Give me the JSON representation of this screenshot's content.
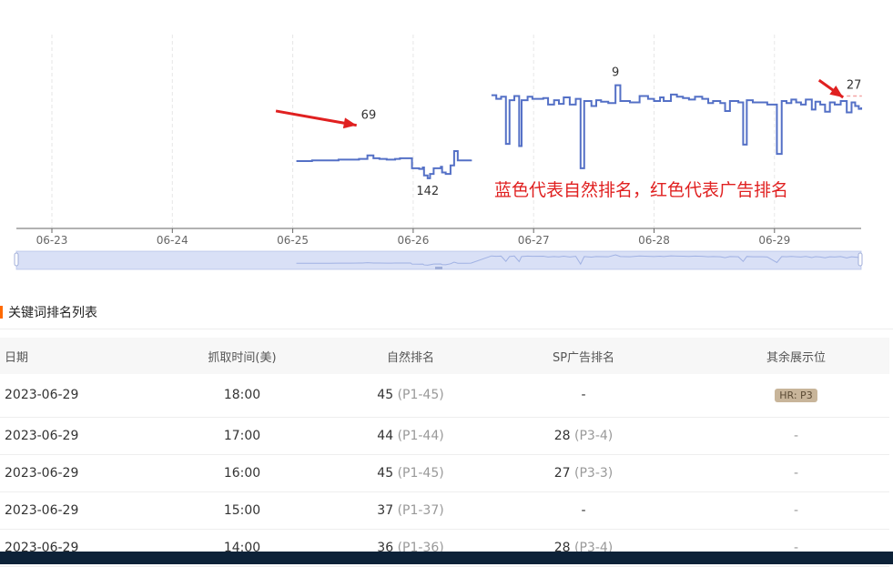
{
  "chart_data": {
    "type": "line",
    "x_ticks": [
      "06-23",
      "06-24",
      "06-25",
      "06-26",
      "06-27",
      "06-28",
      "06-29"
    ],
    "y_axis": {
      "reversed": true,
      "ylim": [
        1,
        160
      ],
      "visible": false
    },
    "grid": {
      "x": true,
      "y": false
    },
    "series": [
      {
        "color": "#5470c6",
        "points": [
          [
            2.03,
            118
          ],
          [
            2.09,
            118
          ],
          [
            2.16,
            117
          ],
          [
            2.21,
            117
          ],
          [
            2.31,
            117
          ],
          [
            2.38,
            116
          ],
          [
            2.44,
            116
          ],
          [
            2.49,
            116
          ],
          [
            2.55,
            115
          ],
          [
            2.58,
            115
          ],
          [
            2.62,
            110
          ],
          [
            2.67,
            114
          ],
          [
            2.72,
            115
          ],
          [
            2.78,
            116
          ],
          [
            2.82,
            116
          ],
          [
            2.85,
            115
          ],
          [
            2.89,
            114
          ],
          [
            2.93,
            114
          ],
          [
            2.98,
            114
          ],
          [
            2.99,
            128
          ],
          [
            3.05,
            129
          ],
          [
            3.08,
            127
          ],
          [
            3.09,
            138
          ],
          [
            3.12,
            142
          ],
          [
            3.14,
            136
          ],
          [
            3.17,
            128
          ],
          [
            3.23,
            126
          ],
          [
            3.24,
            134
          ],
          [
            3.27,
            136
          ],
          [
            3.31,
            124
          ],
          [
            3.34,
            104
          ],
          [
            3.37,
            117
          ],
          [
            3.44,
            117
          ],
          [
            3.48,
            116
          ],
          [
            3.65,
            26
          ],
          [
            3.69,
            31
          ],
          [
            3.73,
            28
          ],
          [
            3.77,
            94
          ],
          [
            3.8,
            33
          ],
          [
            3.84,
            27
          ],
          [
            3.88,
            97
          ],
          [
            3.9,
            33
          ],
          [
            3.95,
            28
          ],
          [
            3.99,
            31
          ],
          [
            4.08,
            30
          ],
          [
            4.12,
            39
          ],
          [
            4.17,
            33
          ],
          [
            4.21,
            38
          ],
          [
            4.25,
            29
          ],
          [
            4.3,
            39
          ],
          [
            4.35,
            31
          ],
          [
            4.39,
            128
          ],
          [
            4.42,
            34
          ],
          [
            4.48,
            41
          ],
          [
            4.52,
            33
          ],
          [
            4.56,
            35
          ],
          [
            4.62,
            37
          ],
          [
            4.68,
            12
          ],
          [
            4.72,
            34
          ],
          [
            4.8,
            36
          ],
          [
            4.88,
            27
          ],
          [
            4.95,
            31
          ],
          [
            5.0,
            34
          ],
          [
            5.05,
            29
          ],
          [
            5.08,
            34
          ],
          [
            5.14,
            25
          ],
          [
            5.19,
            28
          ],
          [
            5.24,
            30
          ],
          [
            5.29,
            32
          ],
          [
            5.34,
            28
          ],
          [
            5.4,
            31
          ],
          [
            5.45,
            37
          ],
          [
            5.49,
            34
          ],
          [
            5.55,
            37
          ],
          [
            5.59,
            48
          ],
          [
            5.63,
            34
          ],
          [
            5.7,
            36
          ],
          [
            5.74,
            95
          ],
          [
            5.77,
            33
          ],
          [
            5.82,
            36
          ],
          [
            5.9,
            36
          ],
          [
            5.94,
            39
          ],
          [
            6.02,
            108
          ],
          [
            6.06,
            34
          ],
          [
            6.1,
            37
          ],
          [
            6.14,
            32
          ],
          [
            6.18,
            36
          ],
          [
            6.22,
            39
          ],
          [
            6.26,
            32
          ],
          [
            6.31,
            46
          ],
          [
            6.34,
            35
          ],
          [
            6.38,
            39
          ],
          [
            6.42,
            49
          ],
          [
            6.46,
            36
          ],
          [
            6.5,
            39
          ],
          [
            6.55,
            34
          ],
          [
            6.6,
            50
          ],
          [
            6.64,
            36
          ],
          [
            6.67,
            41
          ],
          [
            6.7,
            45
          ],
          [
            6.72,
            43
          ]
        ]
      },
      {
        "color": "#f4a4a4",
        "points": [
          [
            2.63,
            69
          ],
          [
            6.6,
            27
          ],
          [
            6.66,
            27
          ],
          [
            6.72,
            28
          ]
        ]
      }
    ],
    "data_labels": [
      {
        "text": "69",
        "x": 2.63,
        "y": 69
      },
      {
        "text": "142",
        "x": 3.12,
        "y": 142
      },
      {
        "text": "9",
        "x": 4.68,
        "y": 9
      },
      {
        "text": "27",
        "x": 6.66,
        "y": 27
      }
    ],
    "annotation": {
      "text": "蓝色代表自然排名，红色代表广告排名",
      "color": "#e02020"
    },
    "arrows": [
      {
        "from": [
          1.86,
          48
        ],
        "to": [
          2.53,
          68
        ],
        "color": "#e02020"
      },
      {
        "from": [
          6.37,
          5
        ],
        "to": [
          6.57,
          29
        ],
        "color": "#e02020"
      }
    ],
    "range_selector": {
      "start": 0.0,
      "end": 1.0
    }
  },
  "section": {
    "title": "关键词排名列表"
  },
  "table": {
    "headers": [
      "日期",
      "抓取时间(美)",
      "自然排名",
      "SP广告排名",
      "其余展示位"
    ],
    "rows": [
      {
        "date": "2023-06-29",
        "time": "18:00",
        "nat": "45",
        "nat_sub": "(P1-45)",
        "sp": "-",
        "sp_sub": "",
        "other": "HR: P3"
      },
      {
        "date": "2023-06-29",
        "time": "17:00",
        "nat": "44",
        "nat_sub": "(P1-44)",
        "sp": "28",
        "sp_sub": "(P3-4)",
        "other": "-"
      },
      {
        "date": "2023-06-29",
        "time": "16:00",
        "nat": "45",
        "nat_sub": "(P1-45)",
        "sp": "27",
        "sp_sub": "(P3-3)",
        "other": "-"
      },
      {
        "date": "2023-06-29",
        "time": "15:00",
        "nat": "37",
        "nat_sub": "(P1-37)",
        "sp": "-",
        "sp_sub": "",
        "other": "-"
      },
      {
        "date": "2023-06-29",
        "time": "14:00",
        "nat": "36",
        "nat_sub": "(P1-36)",
        "sp": "28",
        "sp_sub": "(P3-4)",
        "other": "-"
      }
    ]
  }
}
